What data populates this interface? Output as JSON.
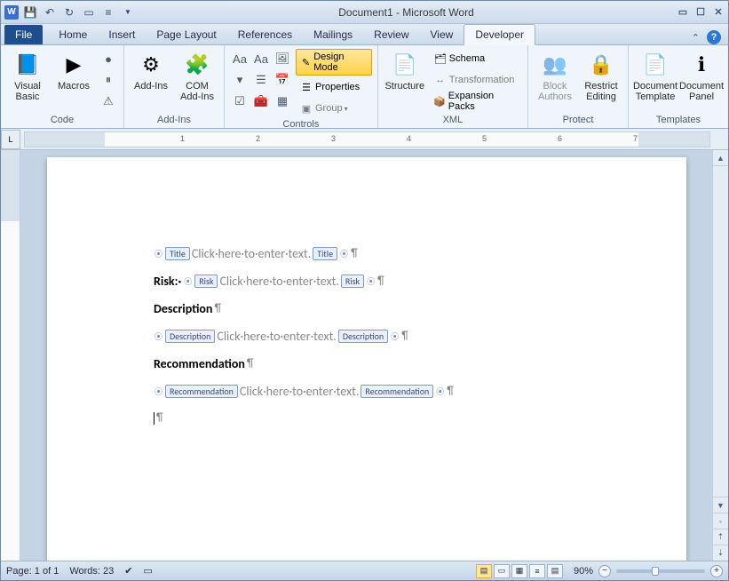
{
  "titlebar": {
    "title": "Document1 - Microsoft Word"
  },
  "tabs": {
    "file": "File",
    "items": [
      "Home",
      "Insert",
      "Page Layout",
      "References",
      "Mailings",
      "Review",
      "View",
      "Developer"
    ],
    "active": "Developer"
  },
  "ribbon": {
    "code": {
      "label": "Code",
      "visual_basic": "Visual\nBasic",
      "macros": "Macros"
    },
    "addins": {
      "label": "Add-Ins",
      "addins": "Add-Ins",
      "com": "COM\nAdd-Ins"
    },
    "controls": {
      "label": "Controls",
      "design_mode": "Design Mode",
      "properties": "Properties",
      "group": "Group"
    },
    "xml": {
      "label": "XML",
      "structure": "Structure",
      "schema": "Schema",
      "transformation": "Transformation",
      "expansion": "Expansion Packs"
    },
    "protect": {
      "label": "Protect",
      "block": "Block\nAuthors",
      "restrict": "Restrict\nEditing"
    },
    "templates": {
      "label": "Templates",
      "template": "Document\nTemplate",
      "panel": "Document\nPanel"
    }
  },
  "document": {
    "placeholder": "Click·here·to·enter·text.",
    "lines": [
      {
        "tag": "Title",
        "prefix": "",
        "suffix": ""
      },
      {
        "tag": "Risk",
        "prefix": "Risk:·",
        "suffix": ""
      }
    ],
    "desc_heading": "Description",
    "desc_tag": "Description",
    "rec_heading": "Recommendation",
    "rec_tag": "Recommendation"
  },
  "statusbar": {
    "page": "Page: 1 of 1",
    "words": "Words: 23",
    "zoom": "90%"
  },
  "ruler_numbers": [
    "1",
    "2",
    "3",
    "4",
    "5",
    "6",
    "7"
  ]
}
